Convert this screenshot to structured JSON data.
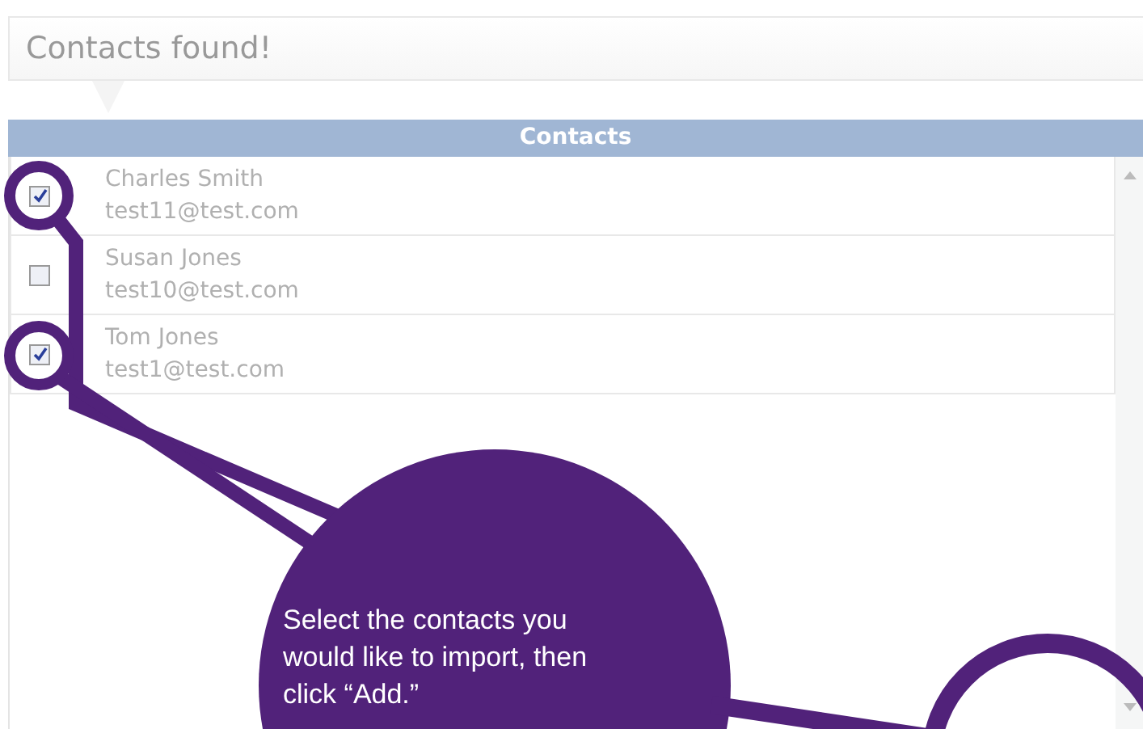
{
  "banner": {
    "text": "Contacts found!"
  },
  "contacts_header": {
    "title": "Contacts"
  },
  "contacts": [
    {
      "name": "Charles Smith",
      "email": "test11@test.com",
      "checked": true
    },
    {
      "name": "Susan Jones",
      "email": "test10@test.com",
      "checked": false
    },
    {
      "name": "Tom Jones",
      "email": "test1@test.com",
      "checked": true
    }
  ],
  "callout": {
    "text": "Select the contacts you would like to import, then click “Add.”"
  }
}
